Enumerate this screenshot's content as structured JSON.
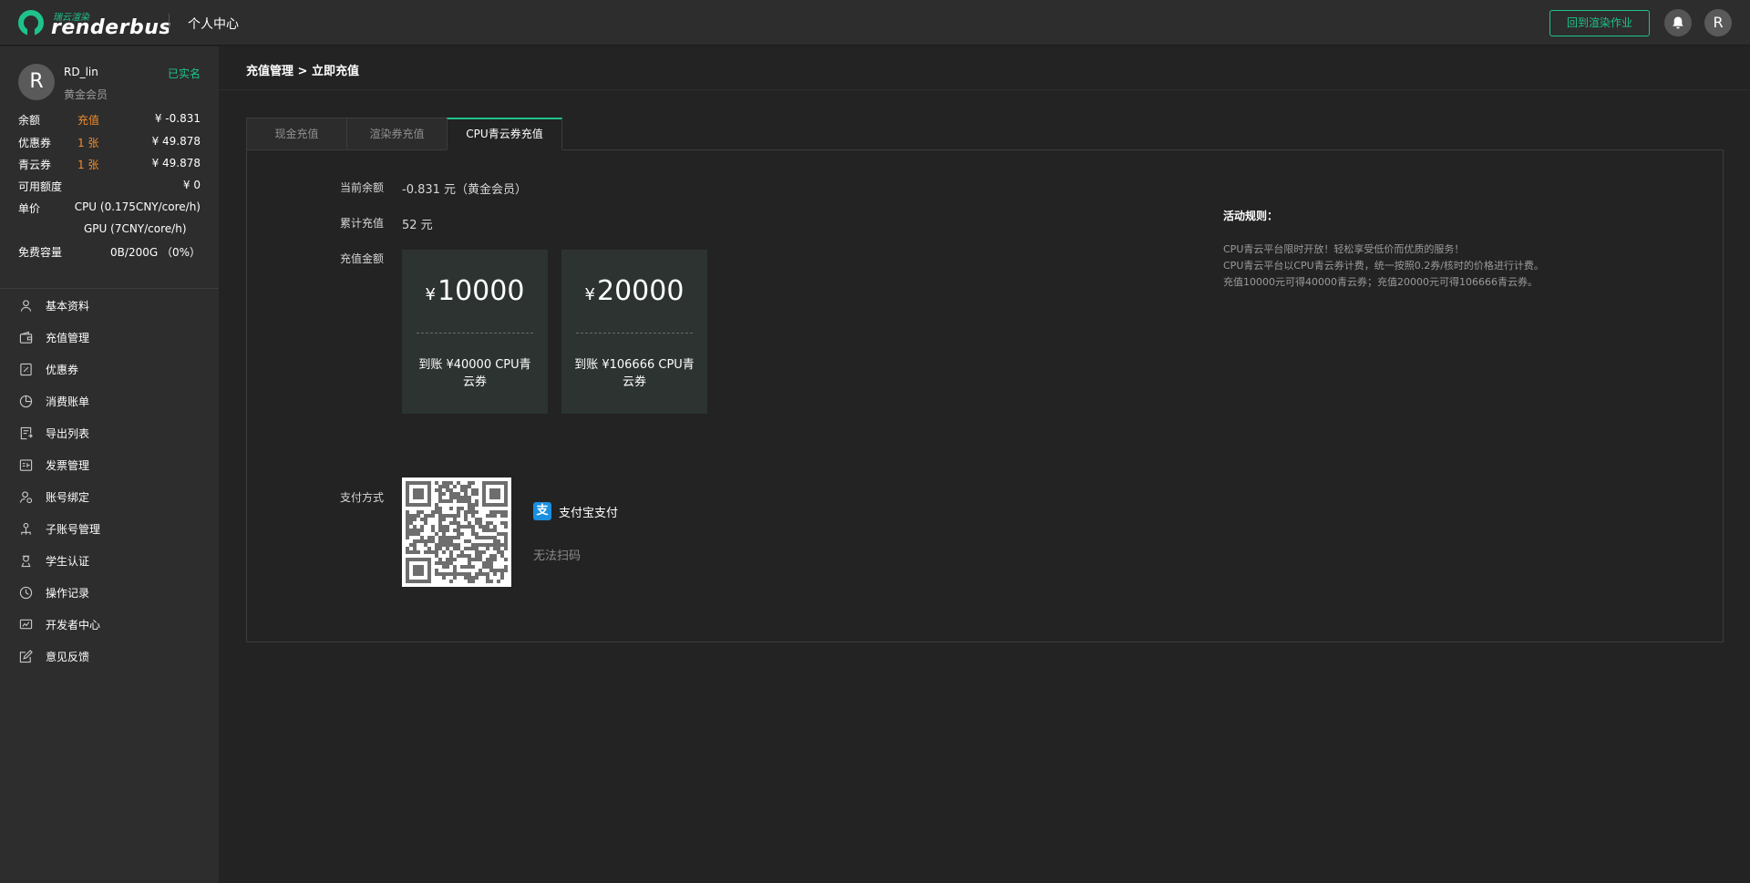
{
  "header": {
    "logo_sub": "瑞云渲染",
    "logo_text": "renderbus",
    "title": "个人中心",
    "back_button": "回到渲染作业",
    "avatar_letter": "R"
  },
  "user": {
    "avatar_letter": "R",
    "name": "RD_lin",
    "level": "黄金会员",
    "verified": "已实名"
  },
  "account_info": {
    "balance_label": "余额",
    "balance_action": "充值",
    "balance_value": "¥ -0.831",
    "coupon_label": "优惠券",
    "coupon_count": "1 张",
    "coupon_value": "¥ 49.878",
    "qingyun_label": "青云券",
    "qingyun_count": "1 张",
    "qingyun_value": "¥ 49.878",
    "credit_label": "可用额度",
    "credit_value": "¥ 0",
    "price_label": "单价",
    "price_cpu": "CPU (0.175CNY/core/h)",
    "price_gpu": "GPU (7CNY/core/h)",
    "storage_label": "免费容量",
    "storage_value": "0B/200G （0%）"
  },
  "nav": {
    "items": [
      {
        "label": "基本资料",
        "icon": "user-icon"
      },
      {
        "label": "充值管理",
        "icon": "wallet-icon"
      },
      {
        "label": "优惠券",
        "icon": "coupon-icon"
      },
      {
        "label": "消费账单",
        "icon": "pie-chart-icon"
      },
      {
        "label": "导出列表",
        "icon": "export-icon"
      },
      {
        "label": "发票管理",
        "icon": "invoice-icon"
      },
      {
        "label": "账号绑定",
        "icon": "user-link-icon"
      },
      {
        "label": "子账号管理",
        "icon": "sub-account-icon"
      },
      {
        "label": "学生认证",
        "icon": "student-icon"
      },
      {
        "label": "操作记录",
        "icon": "clock-icon"
      },
      {
        "label": "开发者中心",
        "icon": "developer-icon"
      },
      {
        "label": "意见反馈",
        "icon": "feedback-icon"
      }
    ]
  },
  "breadcrumb": "充值管理 > 立即充值",
  "tabs": [
    {
      "label": "现金充值",
      "active": false
    },
    {
      "label": "渲染券充值",
      "active": false
    },
    {
      "label": "CPU青云券充值",
      "active": true
    }
  ],
  "recharge": {
    "current_balance_label": "当前余额",
    "current_balance_value": "-0.831 元（黄金会员）",
    "total_label": "累计充值",
    "total_value": "52 元",
    "amount_label": "充值金额",
    "options": [
      {
        "currency": "¥",
        "amount": "10000",
        "desc": "到账 ¥40000 CPU青云券"
      },
      {
        "currency": "¥",
        "amount": "20000",
        "desc": "到账 ¥106666 CPU青云券"
      }
    ],
    "payment_label": "支付方式",
    "alipay_glyph": "支",
    "alipay_label": "支付宝支付",
    "scan_fail": "无法扫码"
  },
  "rules": {
    "title": "活动规则：",
    "lines": [
      "CPU青云平台限时开放！轻松享受低价而优质的服务！",
      "CPU青云平台以CPU青云券计费，统一按照0.2券/核时的价格进行计费。",
      "充值10000元可得40000青云券；充值20000元可得106666青云券。"
    ]
  },
  "colors": {
    "accent": "#1ec38a",
    "orange": "#f08b2c",
    "background": "#232323",
    "sidebar": "#2d2d2d",
    "card": "#2c3330"
  }
}
